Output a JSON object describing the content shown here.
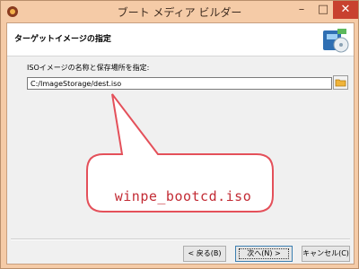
{
  "window": {
    "title": "ブート メディア ビルダー",
    "minimize_glyph": "–",
    "maximize_glyph": "□",
    "close_glyph": "✕"
  },
  "header": {
    "title": "ターゲットイメージの指定"
  },
  "form": {
    "label": "ISOイメージの名称と保存場所を指定:",
    "path_value": "C:/ImageStorage/dest.iso"
  },
  "callout": {
    "text": "winpe_bootcd.iso",
    "color": "#e4505a"
  },
  "buttons": {
    "back": "< 戻る(B)",
    "next": "次へ(N) >",
    "cancel": "キャンセル(C)"
  },
  "colors": {
    "titlebar": "#f5cba7",
    "close": "#c8412f",
    "accent_blue": "#3c7fb1"
  }
}
